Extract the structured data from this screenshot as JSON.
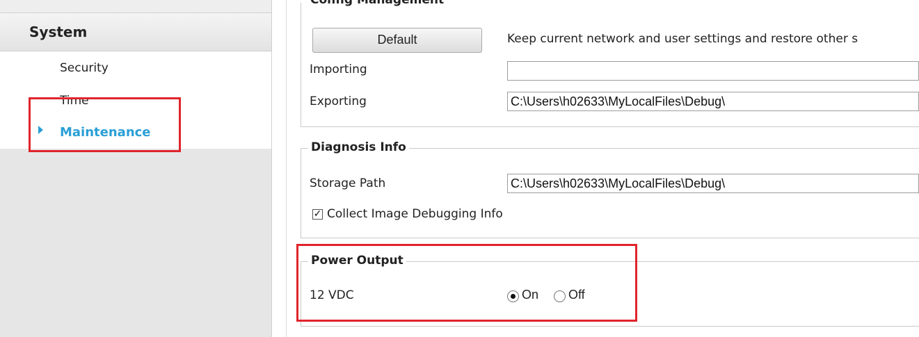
{
  "sidebar": {
    "section_label": "System",
    "items": [
      {
        "label": "Security"
      },
      {
        "label": "Time"
      },
      {
        "label": "Maintenance",
        "active": true
      }
    ],
    "accent_color": "#2a9fd6"
  },
  "config_management": {
    "title": "Config Management",
    "default_button": "Default",
    "default_description": "Keep current network and user settings and restore other s",
    "importing_label": "Importing",
    "importing_value": "",
    "exporting_label": "Exporting",
    "exporting_value": "C:\\Users\\h02633\\MyLocalFiles\\Debug\\"
  },
  "diagnosis_info": {
    "title": "Diagnosis Info",
    "storage_path_label": "Storage Path",
    "storage_path_value": "C:\\Users\\h02633\\MyLocalFiles\\Debug\\",
    "collect_image_debug_label": "Collect Image Debugging Info",
    "collect_image_debug_checked": true
  },
  "power_output": {
    "title": "Power Output",
    "vdc_label": "12 VDC",
    "option_on": "On",
    "option_off": "Off",
    "selected": "On"
  },
  "highlight_color": "#e0242b"
}
